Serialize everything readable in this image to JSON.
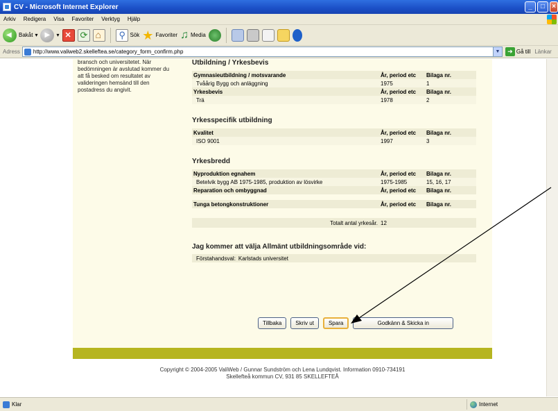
{
  "window": {
    "title": "CV - Microsoft Internet Explorer"
  },
  "menu": [
    "Arkiv",
    "Redigera",
    "Visa",
    "Favoriter",
    "Verktyg",
    "Hjälp"
  ],
  "toolbar": {
    "back_label": "Bakåt",
    "search_label": "Sök",
    "favorites_label": "Favoriter",
    "media_label": "Media"
  },
  "address": {
    "label": "Adress",
    "url": "http://www.valiweb2.skelleftea.se/category_form_confirm.php",
    "go_label": "Gå till",
    "links_label": "Länkar"
  },
  "sidebar_text": "bransch och universitetet. När bedömningen är avslutad kommer du att få besked om resultatet av valideringen hemsänd till den postadress du angivit.",
  "education": {
    "title": "Utbildning / Yrkesbevis",
    "col_period": "År, period etc",
    "col_bilaga": "Bilaga nr.",
    "gym_header": "Gymnasieutbildning / motsvarande",
    "gym_rows": [
      {
        "name": "Tvåårig Bygg och anläggning",
        "period": "1975",
        "bilaga": "1"
      }
    ],
    "yb_header": "Yrkesbevis",
    "yb_rows": [
      {
        "name": "Trä",
        "period": "1978",
        "bilaga": "2"
      }
    ]
  },
  "specific": {
    "title": "Yrkesspecifik utbildning",
    "header": "Kvalitet",
    "rows": [
      {
        "name": "ISO 9001",
        "period": "1997",
        "bilaga": "3"
      }
    ]
  },
  "breadth": {
    "title": "Yrkesbredd",
    "nyprod_header": "Nyproduktion egnahem",
    "nyprod_rows": [
      {
        "name": "Betelvik bygg AB 1975-1985, produktion av lösvirke",
        "period": "1975-1985",
        "bilaga": "15, 16, 17"
      }
    ],
    "rep_header": "Reparation och ombyggnad",
    "tunga_header": "Tunga betongkonstruktioner",
    "total_label": "Totalt antal yrkesår.",
    "total_value": "12"
  },
  "closing": {
    "title": "Jag kommer att välja Allmänt utbildningsområde vid:",
    "first_choice_label": "Förstahandsval:",
    "first_choice_value": "Karlstads universitet"
  },
  "buttons": {
    "back": "Tillbaka",
    "print": "Skriv ut",
    "save": "Spara",
    "submit": "Godkänn & Skicka in"
  },
  "footer": {
    "line1": "Copyright © 2004-2005 ValiWeb / Gunnar Sundström och Lena Lundqvist. Information 0910-734191",
    "line2": "Skellefteå kommun CV, 931 85 SKELLEFTEÅ"
  },
  "status": {
    "left": "Klar",
    "zone": "Internet"
  },
  "colors": {
    "accent_bar": "#b6b520",
    "content_bg": "#fdfbe8",
    "row_bg": "#eeecd5"
  }
}
